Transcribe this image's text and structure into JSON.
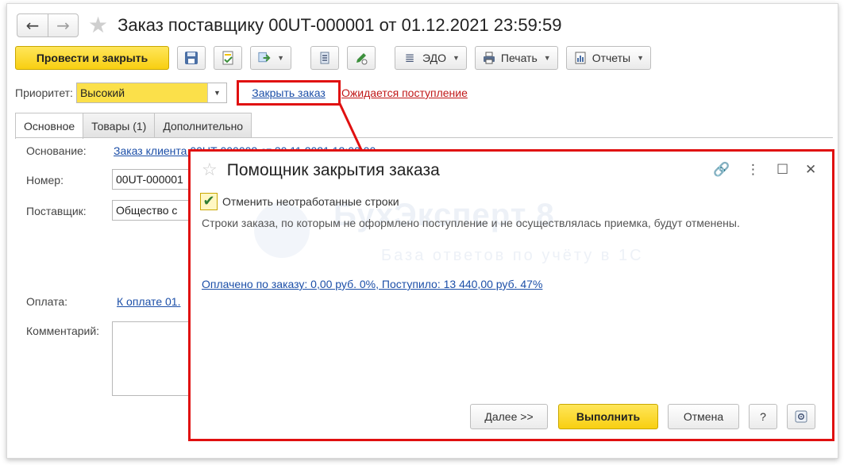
{
  "window": {
    "title": "Заказ поставщику 00UT-000001 от 01.12.2021 23:59:59",
    "nav_back": "←",
    "nav_forward": "→",
    "fav_star": "★"
  },
  "toolbar": {
    "post_close_label": "Провести и закрыть",
    "edo_label": "ЭДО",
    "print_label": "Печать",
    "reports_label": "Отчеты",
    "caret": "▼"
  },
  "priority": {
    "label": "Приоритет:",
    "value": "Высокий",
    "caret": "▼"
  },
  "links": {
    "close_order": "Закрыть заказ",
    "expected_receipt": "Ожидается поступление"
  },
  "tabs": [
    {
      "label": "Основное",
      "active": true
    },
    {
      "label": "Товары (1)",
      "active": false
    },
    {
      "label": "Дополнительно",
      "active": false
    }
  ],
  "form": {
    "basis_label": "Основание:",
    "basis_value": "Заказ клиента 00UT-000002 от 30.11.2021 12:00:00",
    "number_label": "Номер:",
    "number_value": "00UT-000001",
    "supplier_label": "Поставщик:",
    "supplier_value": "Общество с",
    "payment_label": "Оплата:",
    "payment_value": "К оплате 01.",
    "comment_label": "Комментарий:"
  },
  "dialog": {
    "title": "Помощник закрытия заказа",
    "star": "☆",
    "checkbox_label": "Отменить неотработанные строки",
    "checkbox_checked": true,
    "checkmark": "✔",
    "description": "Строки заказа, по которым не оформлено поступление и не осуществлялась приемка, будут отменены.",
    "summary_link": "Оплачено по заказу: 0,00  руб.  0%, Поступило: 13 440,00 руб.  47%",
    "watermark_main": "БухЭксперт 8",
    "watermark_sub": "База ответов по учёту в 1С",
    "buttons": {
      "next": "Далее >>",
      "execute": "Выполнить",
      "cancel": "Отмена",
      "help": "?"
    },
    "controls": {
      "link_icon": "🔗",
      "more_icon": "⋮",
      "maximize_icon": "☐",
      "close_icon": "✕"
    }
  },
  "colors": {
    "accent_yellow": "#f8cf11",
    "highlight_red": "#e01010",
    "link_blue": "#1c4fa8",
    "link_red": "#c01818"
  }
}
